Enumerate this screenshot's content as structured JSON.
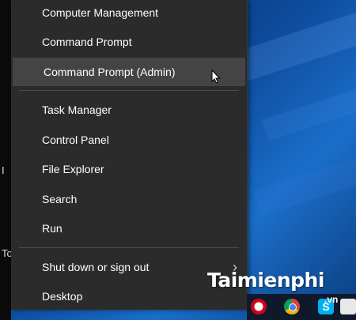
{
  "menu": {
    "items": [
      {
        "label": "Computer Management"
      },
      {
        "label": "Command Prompt"
      },
      {
        "label": "Command Prompt (Admin)"
      },
      {
        "label": "Task Manager"
      },
      {
        "label": "Control Panel"
      },
      {
        "label": "File Explorer"
      },
      {
        "label": "Search"
      },
      {
        "label": "Run"
      },
      {
        "label": "Shut down or sign out"
      },
      {
        "label": "Desktop"
      }
    ],
    "highlighted": "Command Prompt (Admin)"
  },
  "desktop": {
    "left_edge_text": [
      "I",
      "To"
    ]
  },
  "watermark": {
    "brand": "Taimienphi",
    "suffix": ".vn"
  },
  "taskbar": {
    "icons": [
      "opera-icon",
      "chrome-icon",
      "skype-icon",
      "app-icon"
    ]
  },
  "colors": {
    "menu_bg": "#2b2b2b",
    "highlight_bg": "#444444",
    "text": "#ffffff"
  }
}
